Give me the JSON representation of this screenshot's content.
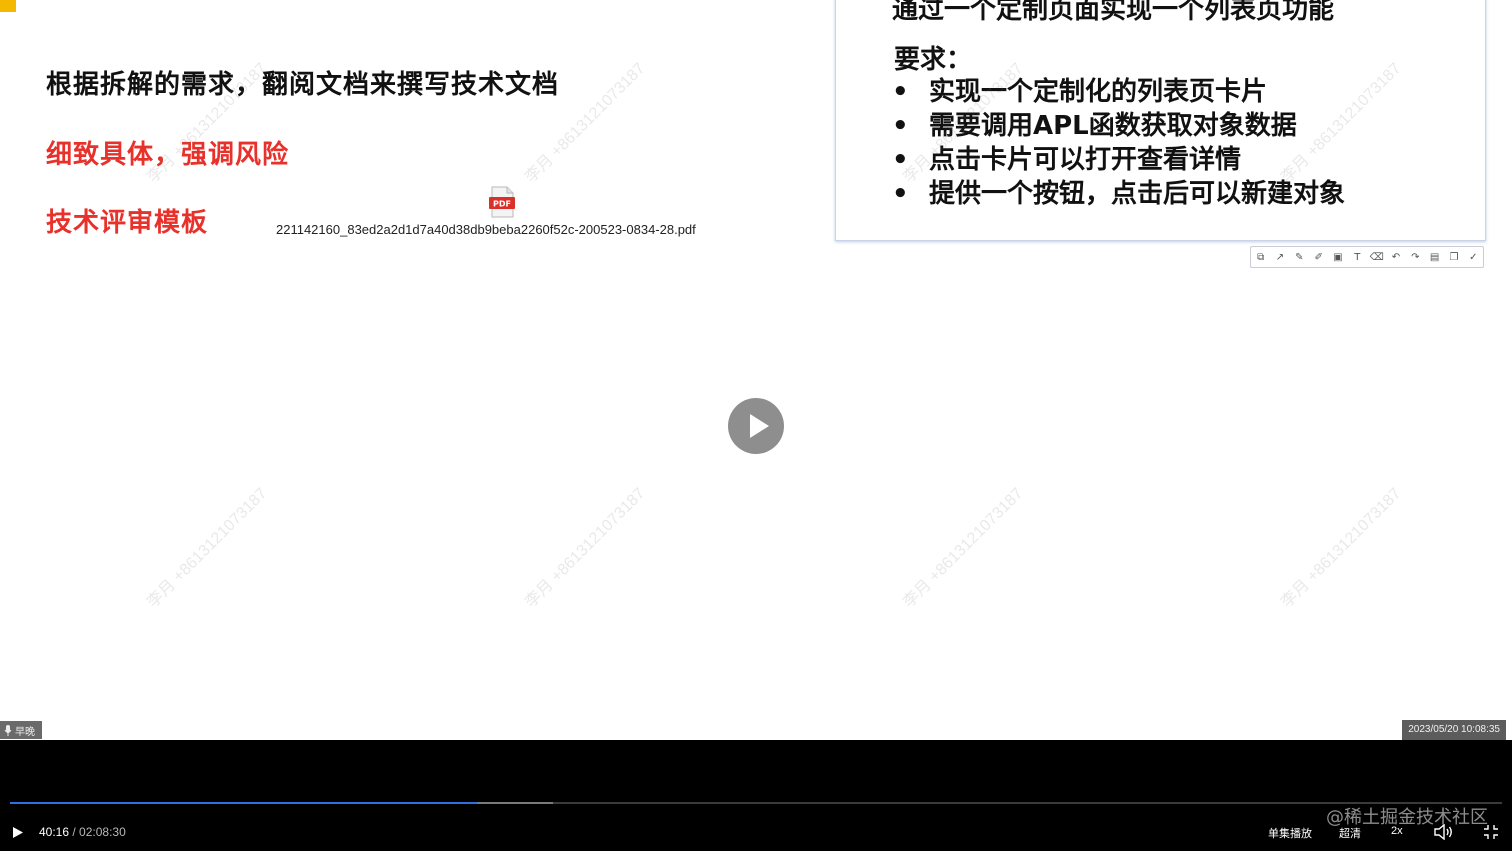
{
  "slide": {
    "heading": "根据拆解的需求，翻阅文档来撰写技术文档",
    "red_line_1": "细致具体，强调风险",
    "red_line_2": "技术评审模板",
    "pdf_filename": "221142160_83ed2a2d1d7a40d38db9beba2260f52c-200523-0834-28.pdf",
    "pdf_icon_label": "PDF"
  },
  "card": {
    "top_text": "通过一个定制页面实现一个列表页功能",
    "req_title": "要求：",
    "bullet": "•",
    "requirements": [
      "实现一个定制化的列表页卡片",
      "需要调用APL函数获取对象数据",
      "点击卡片可以打开查看详情",
      "提供一个按钮，点击后可以新建对象"
    ]
  },
  "annotation_toolbar": {
    "icons": [
      "crop-icon",
      "line-icon",
      "pen-icon",
      "highlighter-icon",
      "mosaic-icon",
      "text-icon",
      "eraser-icon",
      "undo-icon",
      "redo-icon",
      "save-icon",
      "copy-icon",
      "confirm-icon"
    ],
    "glyphs": [
      "⧉",
      "↗",
      "✎",
      "✐",
      "▣",
      "T",
      "⌫",
      "↶",
      "↷",
      "▤",
      "❐",
      "✓"
    ]
  },
  "watermark_text": "李月 +8613121073187",
  "overlay": {
    "mic_label": "早晚",
    "timestamp": "2023/05/20 10:08:35"
  },
  "player": {
    "current_time": "40:16",
    "separator": " / ",
    "duration": "02:08:30",
    "progress_fraction": 0.313,
    "buffered_fraction": 0.364,
    "single_play_label": "单集播放",
    "quality_label": "超清",
    "speed_label": "2x",
    "site_watermark": "@稀土掘金技术社区"
  },
  "colors": {
    "accent_red": "#e8312a",
    "progress_blue": "#2f6fe0",
    "tab_yellow": "#f5b800"
  }
}
